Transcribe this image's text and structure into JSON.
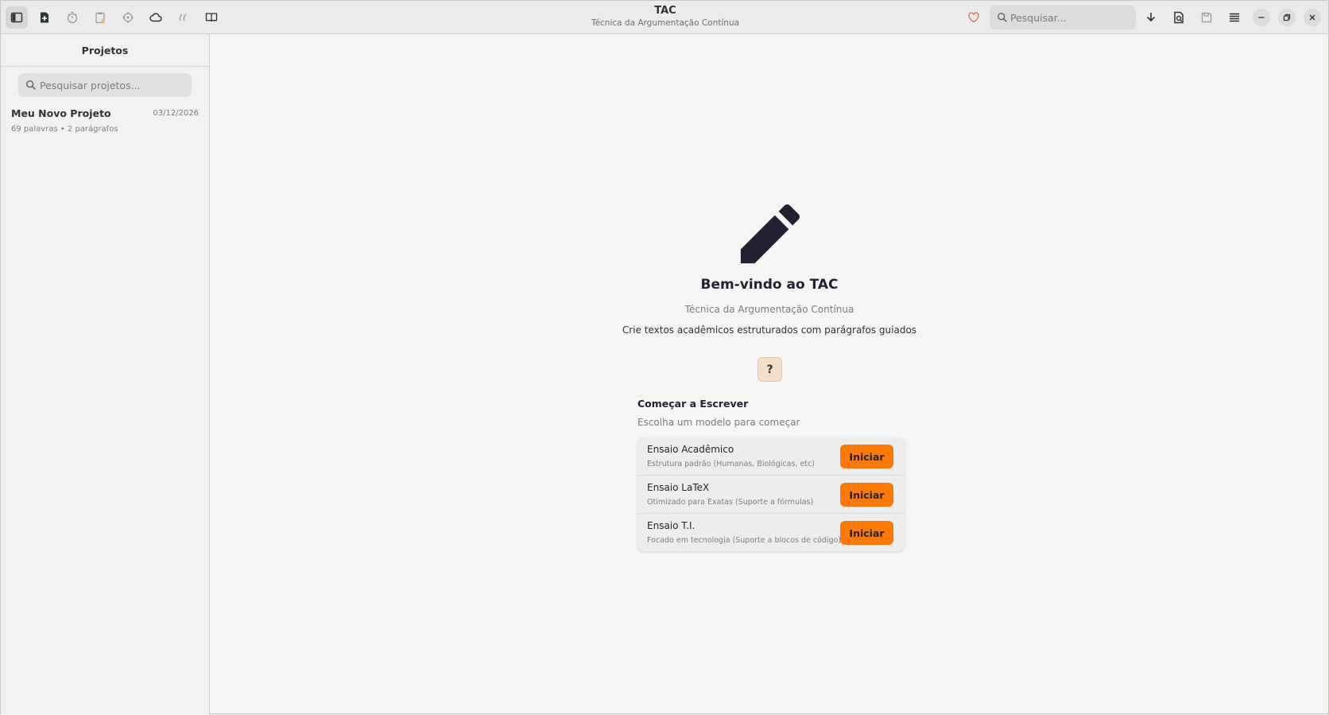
{
  "header": {
    "title": "TAC",
    "subtitle": "Técnica da Argumentação Contínua",
    "search_placeholder": "Pesquisar...",
    "icons": [
      "sidebar-toggle-icon",
      "new-document-icon",
      "timer-icon",
      "clipboard-icon",
      "target-icon",
      "cloud-icon",
      "quote-icon",
      "book-icon",
      "heart-icon",
      "search-icon",
      "download-icon",
      "export-icon",
      "save-icon",
      "menu-icon",
      "minimize-icon",
      "maximize-icon",
      "close-icon"
    ]
  },
  "sidebar": {
    "title": "Projetos",
    "search_placeholder": "Pesquisar projetos...",
    "projects": [
      {
        "name": "Meu Novo Projeto",
        "date": "03/12/2026",
        "meta": "69 palavras • 2 parágrafos"
      }
    ]
  },
  "welcome": {
    "title": "Bem-vindo ao TAC",
    "subtitle": "Técnica da Argumentação Contínua",
    "description": "Crie textos acadêmicos estruturados com parágrafos guiados",
    "help_label": "?",
    "section_title": "Começar a Escrever",
    "section_subtitle": "Escolha um modelo para começar",
    "templates": [
      {
        "name": "Ensaio Acadêmico",
        "desc": "Estrutura padrão (Humanas, Biológicas, etc)",
        "button": "Iniciar"
      },
      {
        "name": "Ensaio LaTeX",
        "desc": "Otimizado para Exatas (Suporte a fórmulas)",
        "button": "Iniciar"
      },
      {
        "name": "Ensaio T.I.",
        "desc": "Focado em tecnologia (Suporte a blocos de código)",
        "button": "Iniciar"
      }
    ]
  },
  "colors": {
    "accent": "#ff7800",
    "heart": "#e66565",
    "help_bg": "#f6dfc8"
  }
}
